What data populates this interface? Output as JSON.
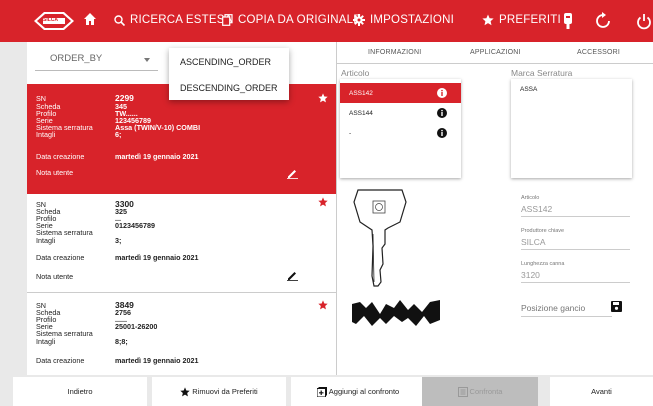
{
  "topbar": {
    "logo_text": "SILCA",
    "nav": [
      {
        "label": "RICERCA ESTESA"
      },
      {
        "label": "COPIA DA ORIGINALE"
      },
      {
        "label": "IMPOSTAZIONI"
      },
      {
        "label": "PREFERITI"
      }
    ]
  },
  "sort": {
    "selected": "ORDER_BY",
    "options": [
      "ASCENDING_ORDER",
      "DESCENDING_ORDER"
    ]
  },
  "field_labels": {
    "sn": "SN",
    "scheda": "Scheda",
    "profilo": "Profilo",
    "serie": "Serie",
    "sistema": "Sistema serratura",
    "intagli": "Intagli",
    "data_creazione": "Data creazione",
    "nota": "Nota utente"
  },
  "cards": [
    {
      "sn": "2299",
      "scheda": "345",
      "profilo": "TW......",
      "serie": "123456789",
      "sistema": "Assa (TWIN/V-10) COMBI",
      "intagli": "6;",
      "data": "martedì 19 gennaio 2021"
    },
    {
      "sn": "3300",
      "scheda": "325",
      "profilo": "...",
      "serie": "0123456789",
      "sistema": "",
      "intagli": "3;",
      "data": "martedì 19 gennaio 2021"
    },
    {
      "sn": "3849",
      "scheda": "2756",
      "profilo": "......",
      "serie": "25001-26200",
      "sistema": "",
      "intagli": "8;8;",
      "data": "martedì 19 gennaio 2021"
    }
  ],
  "tabs": [
    "INFORMAZIONI",
    "APPLICAZIONI",
    "ACCESSORI"
  ],
  "articolo": {
    "label": "Articolo",
    "items": [
      "ASS142",
      "ASS144",
      "-"
    ]
  },
  "marca": {
    "label": "Marca Serratura",
    "value": "ASSA"
  },
  "details": [
    {
      "label": "Articolo",
      "value": "ASS142"
    },
    {
      "label": "Produttore chiave",
      "value": "SILCA"
    },
    {
      "label": "Lunghezza canna",
      "value": "3120"
    }
  ],
  "posizione_gancio": "Posizione gancio",
  "bottom": {
    "indietro": "Indietro",
    "rimuovi": "Rimuovi da Preferiti",
    "aggiungi": "Aggiungi al confronto",
    "confronta": "Confronta",
    "avanti": "Avanti"
  },
  "colors": {
    "accent": "#d8232a"
  }
}
